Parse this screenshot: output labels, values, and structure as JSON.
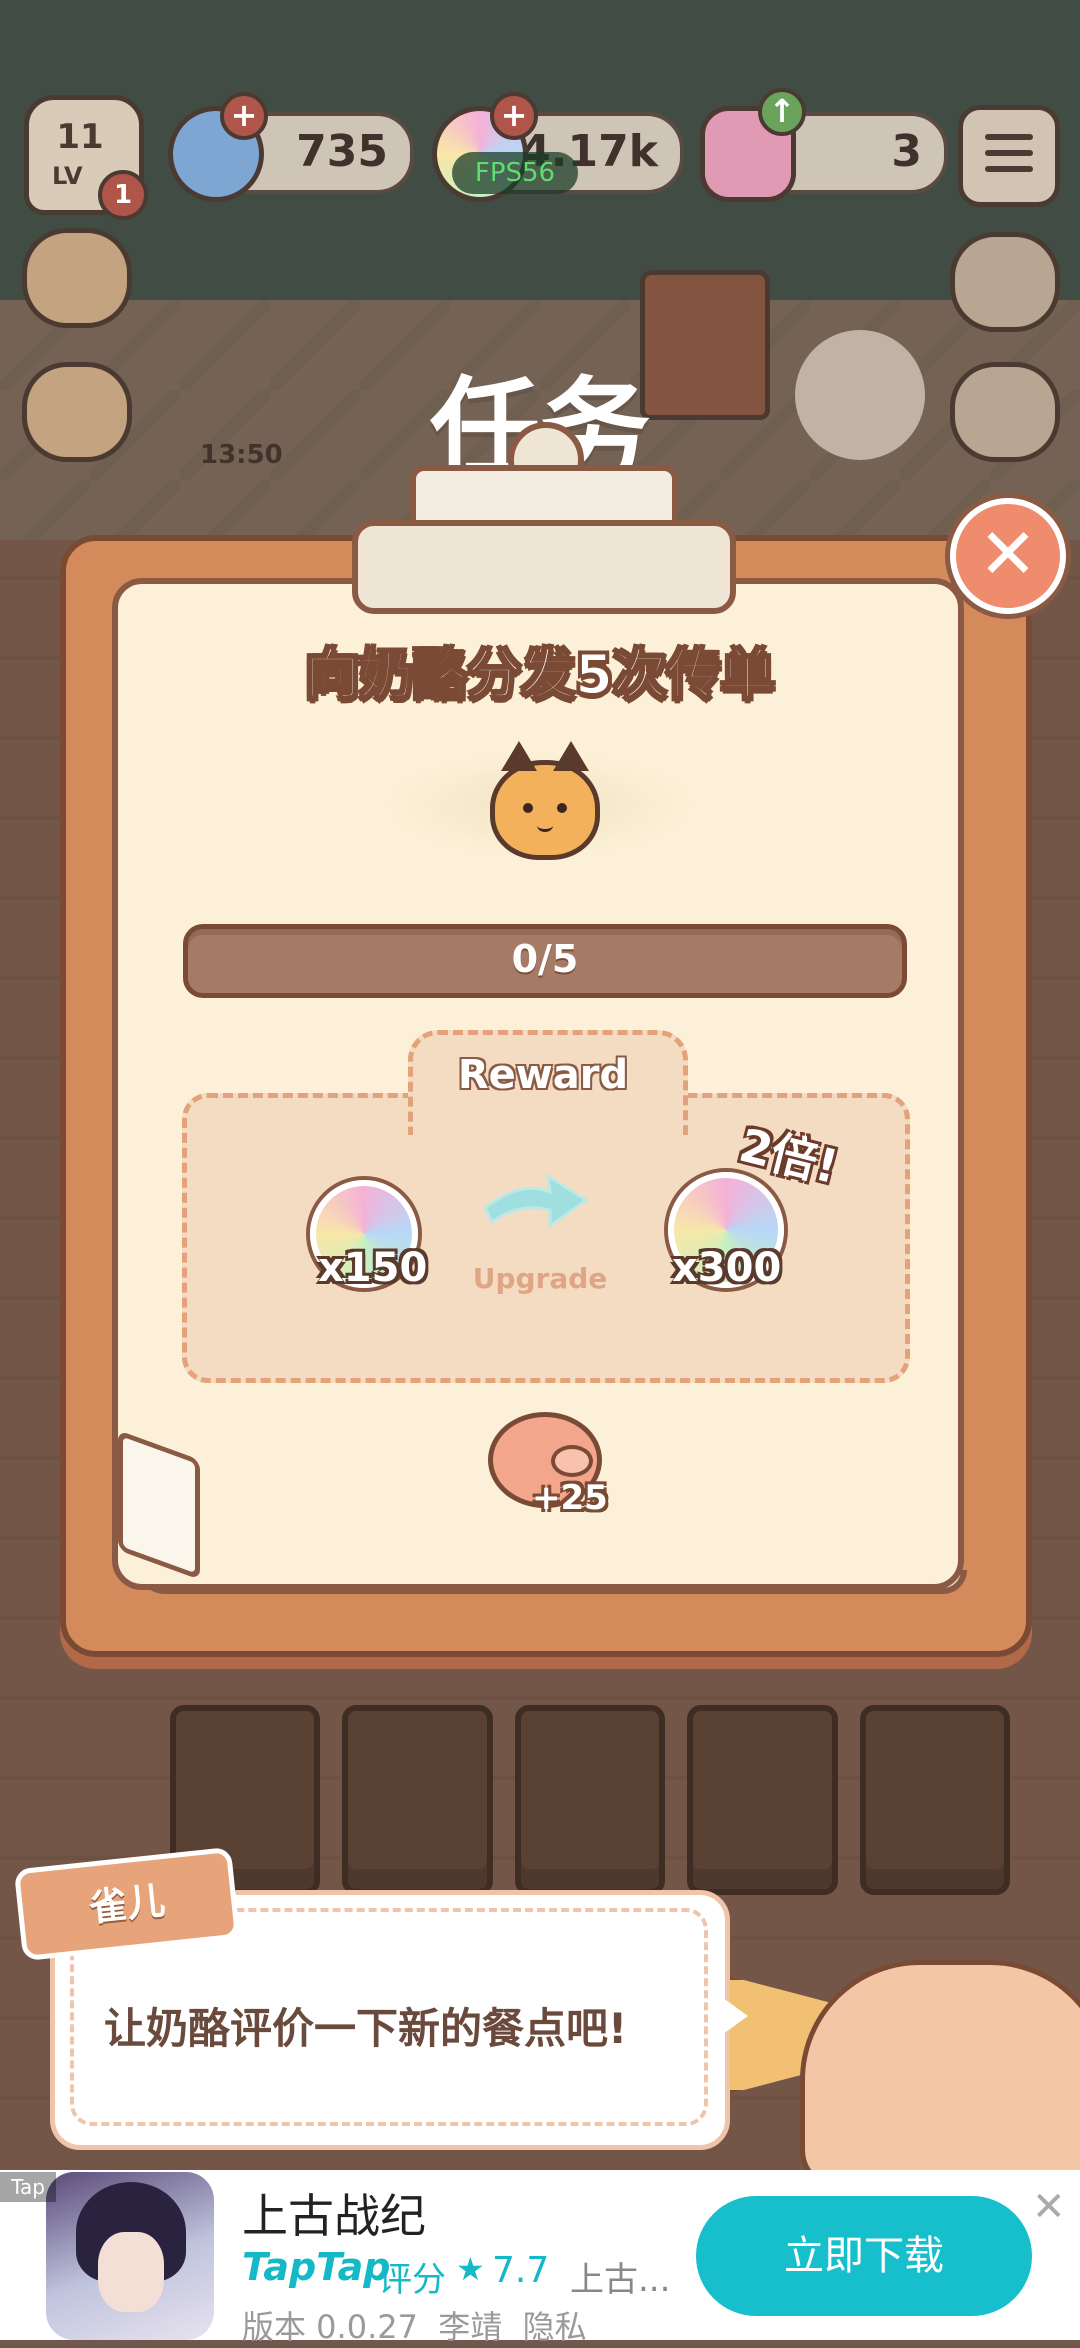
{
  "hud": {
    "level": "11",
    "level_label": "LV",
    "level_badge": "1",
    "gems": "735",
    "orbs": "4.17k",
    "stars": "3",
    "fps": "FPS56",
    "clock": "13:50",
    "plus_symbol": "+"
  },
  "modal": {
    "title": "任务",
    "task": "向奶酪分发5次传单",
    "progress_text": "0/5",
    "progress_fraction": 0,
    "reward_label": "Reward",
    "reward_base": "x150",
    "upgrade_label": "Upgrade",
    "reward_upgraded": "x300",
    "double_badge": "2倍!",
    "bonus": "+25",
    "close_symbol": "✕"
  },
  "dialogue": {
    "speaker": "雀儿",
    "text": "让奶酪评价一下新的餐点吧!"
  },
  "ad": {
    "tag": "Tap",
    "title": "上古战纪",
    "brand": "TapTap",
    "rating_label": "评分",
    "star": "★",
    "rating": "7.7",
    "desc": "上古...",
    "meta": "版本 0.0.27  李靖  隐私",
    "cta": "立即下载",
    "close": "✕"
  },
  "colors": {
    "board": "#d58a5c",
    "paper": "#fcf1d8",
    "accent_teal": "#16bfcb",
    "close_button": "#f08c6e"
  },
  "icons": [
    "chef-hat-icon",
    "gem-icon",
    "orb-icon",
    "star-icon",
    "menu-icon",
    "cat-icon",
    "orb-reward-icon",
    "arrow-right-icon",
    "pig-icon",
    "close-icon"
  ]
}
